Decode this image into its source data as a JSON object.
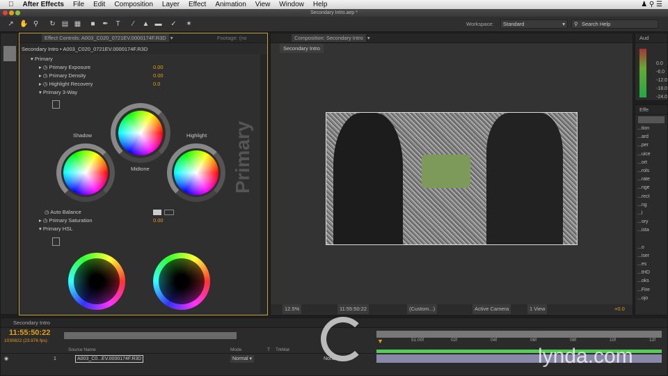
{
  "menubar": {
    "app": "After Effects",
    "items": [
      "File",
      "Edit",
      "Composition",
      "Layer",
      "Effect",
      "Animation",
      "View",
      "Window",
      "Help"
    ]
  },
  "window_title": "Secondary Intro.aep *",
  "toolbar": {
    "workspace_label": "Workspace:",
    "workspace_value": "Standard",
    "search_placeholder": "Search Help"
  },
  "effect_controls": {
    "tab": "Effect Controls: A003_C020_0721EV.0000174F.R3D",
    "tab2": "Footage: (no",
    "breadcrumb": "Secondary Intro • A003_C020_0721EV.0000174F.R3D",
    "group": "Primary",
    "props": [
      {
        "label": "Primary Exposure",
        "value": "0.00"
      },
      {
        "label": "Primary Density",
        "value": "0.00"
      },
      {
        "label": "Highlight Recovery",
        "value": "0.0"
      }
    ],
    "three_way": "Primary 3-Way",
    "shadow": "Shadow",
    "midtone": "Midtone",
    "highlight": "Highlight",
    "watermark": "Primary",
    "auto_balance": "Auto Balance",
    "saturation_label": "Primary Saturation",
    "saturation_value": "0.00",
    "hsl": "Primary HSL"
  },
  "composition": {
    "tab": "Composition: Secondary Intro",
    "subtab": "Secondary Intro",
    "footer": {
      "zoom": "12.5%",
      "timecode": "11:55:50:22",
      "channel": "(Custom...)",
      "camera": "Active Camera",
      "view": "1 View",
      "exposure": "+0.0"
    }
  },
  "audio": {
    "tab": "Aud",
    "levels": [
      "0.0",
      "-6.0",
      "-12.0",
      "-18.0",
      "-24.0"
    ]
  },
  "effects_presets": {
    "tab": "Effe",
    "items": [
      "...tion",
      "...ard",
      "...per",
      "...uice",
      "...ort",
      "...rols",
      "...rate",
      "...nge",
      "...rect",
      "...ng",
      "...l",
      "...ory",
      "...ista",
      "...o",
      "...iser",
      "...es",
      "...tHD",
      "...oks",
      "...Fire",
      "...ojo"
    ]
  },
  "timeline": {
    "tab": "Secondary Intro",
    "timecode": "11:55:50:22",
    "frame_info": "1030822 (23.976 fps)",
    "search_placeholder": "",
    "columns": {
      "source": "Source Name",
      "mode": "Mode",
      "t": "T",
      "trkmat": "TrkMat"
    },
    "layer": {
      "index": "1",
      "name": "A003_C0...EV.0000174F.R3D",
      "mode": "Normal",
      "trkmat": "None"
    },
    "ruler": [
      "51:00f",
      "02f",
      "04f",
      "06f",
      "08f",
      "10f",
      "12f"
    ]
  },
  "watermark": "lynda.com"
}
